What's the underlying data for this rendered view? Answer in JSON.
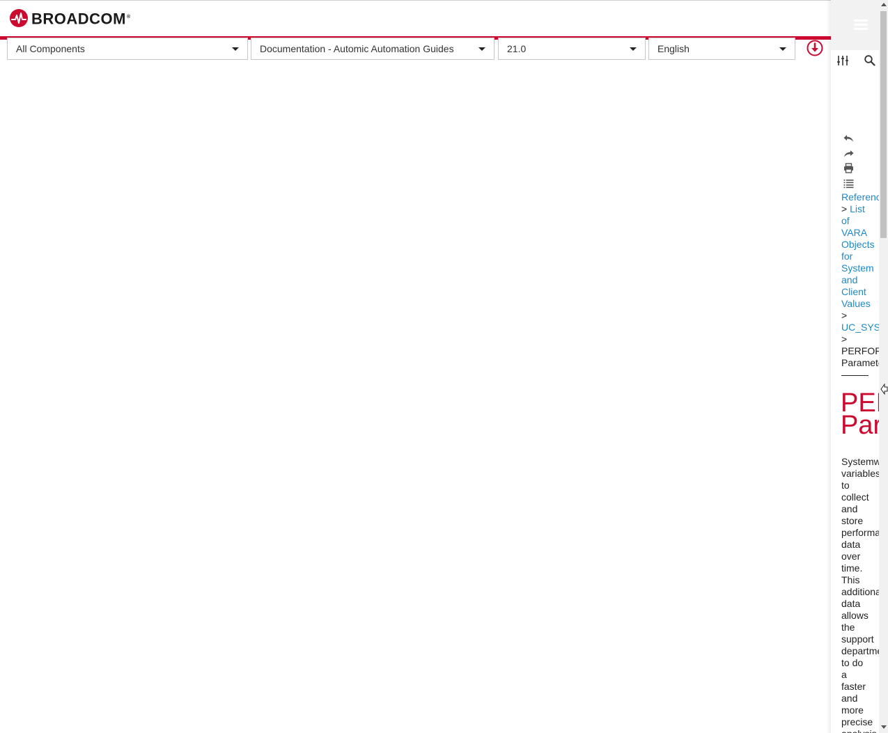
{
  "header": {
    "brand": "BROADCOM",
    "brand_mark": "®",
    "logo_icon": "broadcom-logo-icon",
    "accent_color": "#cc092f"
  },
  "filters": {
    "component": "All Components",
    "collection": "Documentation - Automic Automation Guides",
    "version": "21.0",
    "language": "English"
  },
  "download_icon": "download-circle-icon",
  "sidebar": {
    "menu_icon": "hamburger-menu-icon",
    "tools": [
      "filter-sliders-icon",
      "search-icon"
    ],
    "actions": [
      "back-icon",
      "forward-icon",
      "print-icon",
      "toc-list-icon"
    ],
    "breadcrumb": {
      "items": [
        {
          "label": "Reference",
          "link": true
        },
        {
          "label": "List of VARA Objects for System and Client Values",
          "link": true
        },
        {
          "label": "UC_SYSTEM_SETTINGS",
          "link": true
        },
        {
          "label": "PERFORMANCE Parameters",
          "link": false
        }
      ],
      "rows": [
        {
          "sep": "",
          "text": "Reference"
        },
        {
          "sep": "> ",
          "text": "List"
        },
        {
          "sep": "",
          "text": "of"
        },
        {
          "sep": "",
          "text": "VARA"
        },
        {
          "sep": "",
          "text": "Objects"
        },
        {
          "sep": "",
          "text": "for"
        },
        {
          "sep": "",
          "text": "System"
        },
        {
          "sep": "",
          "text": "and"
        },
        {
          "sep": "",
          "text": "Client"
        },
        {
          "sep": "",
          "text": "Values"
        },
        {
          "sep": ">",
          "text": ""
        },
        {
          "sep": "",
          "text": "UC_SYSTEM_SETTINGS"
        },
        {
          "sep": ">",
          "text": ""
        }
      ],
      "current_rows": [
        "PERFORMANCE",
        "Parameters"
      ]
    },
    "page_title_rows": [
      "PERFORMANCE",
      "Parameters"
    ],
    "body_rows": [
      "Systemwide",
      "variables",
      "to",
      "collect",
      "and",
      "store",
      "performance",
      "data",
      "over",
      "time.",
      "This",
      "additional",
      "data",
      "allows",
      "the",
      "support",
      "department",
      "to do",
      "a",
      "faster",
      "and",
      "more",
      "precise",
      "analysis"
    ]
  }
}
